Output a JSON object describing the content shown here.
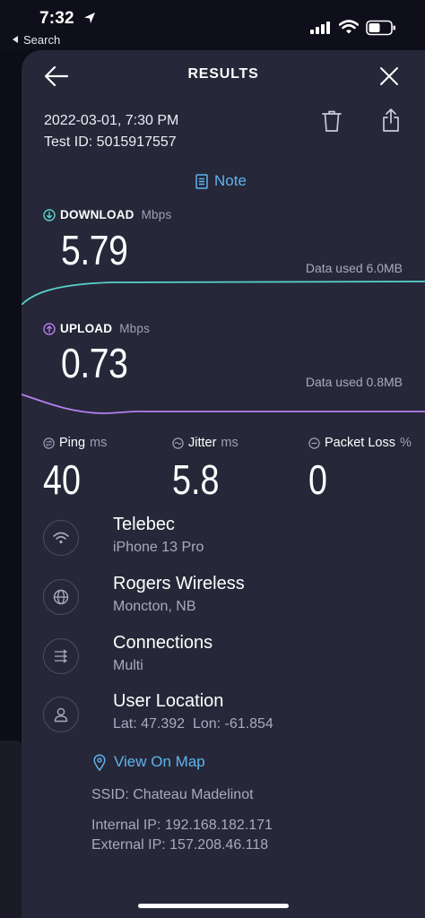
{
  "status_bar": {
    "time": "7:32",
    "back_label": "Search"
  },
  "header": {
    "title": "RESULTS"
  },
  "test": {
    "datetime": "2022-03-01, 7:30 PM",
    "test_id": "Test ID: 5015917557"
  },
  "note_label": "Note",
  "download": {
    "label": "DOWNLOAD",
    "unit": "Mbps",
    "value": "5.79",
    "data_used": "Data used 6.0MB",
    "color": "#59d3cd"
  },
  "upload": {
    "label": "UPLOAD",
    "unit": "Mbps",
    "value": "0.73",
    "data_used": "Data used 0.8MB",
    "color": "#b47ff0"
  },
  "stats": {
    "ping": {
      "label": "Ping",
      "unit": "ms",
      "value": "40"
    },
    "jitter": {
      "label": "Jitter",
      "unit": "ms",
      "value": "5.8"
    },
    "packet_loss": {
      "label": "Packet Loss",
      "unit": "%",
      "value": "0"
    }
  },
  "details": [
    {
      "title": "Telebec",
      "subtitle": "iPhone 13 Pro",
      "icon": "wifi-icon"
    },
    {
      "title": "Rogers Wireless",
      "subtitle": "Moncton, NB",
      "icon": "globe-icon"
    },
    {
      "title": "Connections",
      "subtitle": "Multi",
      "icon": "connections-icon"
    },
    {
      "title": "User Location",
      "subtitle": "Lat: 47.392  Lon: -61.854",
      "icon": "user-icon"
    }
  ],
  "map_link": "View On Map",
  "ssid": "SSID: Chateau Madelinot",
  "internal_ip": "Internal IP: 192.168.182.171",
  "external_ip": "External IP: 157.208.46.118",
  "colors": {
    "background": "#262738",
    "accent_link": "#5eb4ee"
  }
}
